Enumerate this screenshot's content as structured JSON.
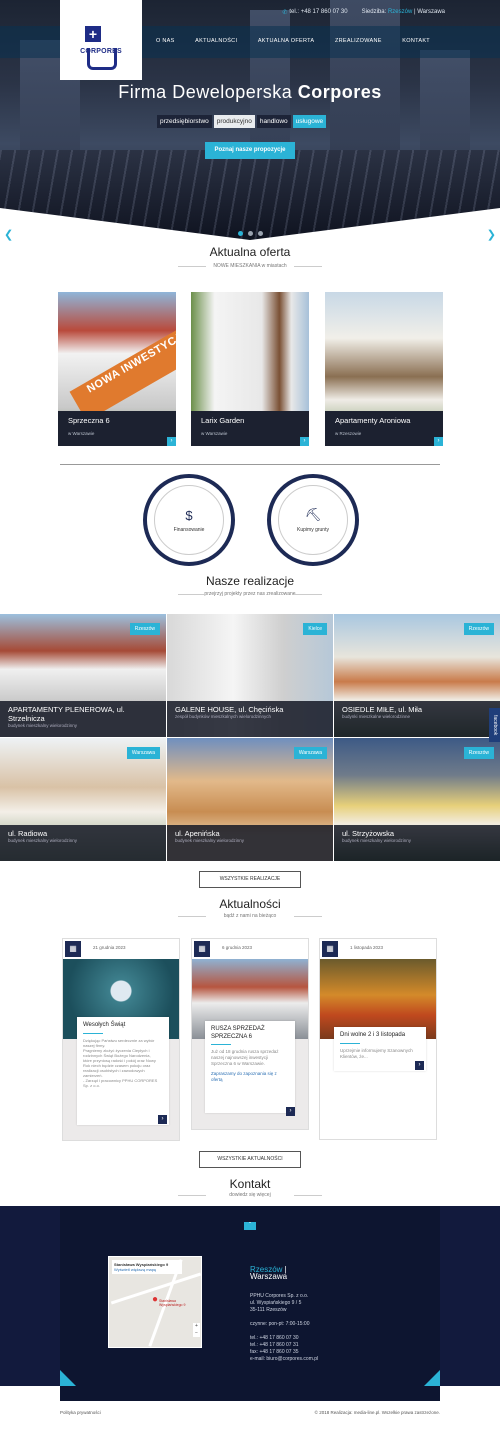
{
  "topbar": {
    "phone": "tel.: +48 17 860 07 30",
    "seat_label": "Siedziba:",
    "seat_active": "Rzeszów",
    "seat_other": "Warszawa"
  },
  "logo": {
    "text": "CORPORES"
  },
  "nav": [
    "O NAS",
    "AKTUALNOŚCI",
    "AKTUALNA OFERTA",
    "ZREALIZOWANE",
    "KONTAKT"
  ],
  "hero": {
    "title_light": "Firma Deweloperska ",
    "title_bold": "Corpores",
    "tags": [
      "przedsiębiorstwo",
      "produkcyjno",
      "handlowo",
      "usługowe"
    ],
    "button": "Poznaj nasze propozycje"
  },
  "offer": {
    "title": "Aktualna oferta",
    "subtitle": "NOWE MIESZKANIA w miastach",
    "cards": [
      {
        "name": "Sprzeczna 6",
        "city": "w Warszawie",
        "ribbon": "NOWA INWESTYCJA"
      },
      {
        "name": "Larix Garden",
        "city": "w Warszawie"
      },
      {
        "name": "Apartamenty Aroniowa",
        "city": "w Rzeszowie"
      }
    ]
  },
  "services": [
    "Finansowanie",
    "Kupimy grunty"
  ],
  "realizations": {
    "title": "Nasze realizacje",
    "subtitle": "przejrzyj projekty przez nas zrealizowane",
    "tiles": [
      {
        "name": "APARTAMENTY PLENEROWA, ul. Strzelnicza",
        "desc": "budynek mieszkalny wielorodzinny",
        "city": "Rzeszów"
      },
      {
        "name": "GALENE HOUSE, ul. Chęcińska",
        "desc": "zespół budynków mieszkalnych wielorodzinnych",
        "city": "Kielce"
      },
      {
        "name": "OSIEDLE MIŁE, ul. Miła",
        "desc": "budynki mieszkalne wielorodzinne",
        "city": "Rzeszów"
      },
      {
        "name": "ul. Radiowa",
        "desc": "budynek mieszkalny wielorodzinny",
        "city": "Warszawa"
      },
      {
        "name": "ul. Apenińska",
        "desc": "budynek mieszkalny wielorodzinny",
        "city": "Warszawa"
      },
      {
        "name": "ul. Strzyżowska",
        "desc": "budynek mieszkalny wielorodzinny",
        "city": "Rzeszów"
      }
    ],
    "all_button": "WSZYSTKIE REALIZACJE",
    "facebook": "facebook"
  },
  "news": {
    "title": "Aktualności",
    "subtitle": "bądź z nami na bieżąco",
    "items": [
      {
        "date": "21 grudnia 2023",
        "title": "Wesołych Świąt",
        "body": "Dziękując Państwu serdecznie za wybór naszej firmy.\nPragniemy złożyć życzenia Ciepłych i rodzinnych Świąt Bożego Narodzenia,\nktóre przyniosą radość i pokój oraz Nowy Rok niech będzie czasem pokoju oraz realizacji osobistych i zawodowych zamierzeń.\n- Zarząd i pracownicy PPHU CORPORES Sp. z o.o.",
        "link": ""
      },
      {
        "date": "6 grudnia 2023",
        "title": "RUSZA SPRZEDAŻ SPRZECZNA 6",
        "body": "Już od 18 grudnia rusza sprzedaż naszej najnowszej inwestycji Sprzeczna 6 w Warszawie.",
        "link": "Zapraszamy do zapoznania się z ofertą"
      },
      {
        "date": "1 listopada 2023",
        "title": "Dni wolne 2 i 3 listopada",
        "body": "Uprzejmie informujemy Szanownych Klientów, że...",
        "link": ""
      }
    ],
    "all_button": "WSZYSTKIE AKTUALNOŚCI"
  },
  "contact": {
    "title": "Kontakt",
    "subtitle": "dowiedz się więcej",
    "map_place": "Stanisława Wyspiańskiego 9",
    "map_link": "Wyświetl większą mapę",
    "map_pin": "Stanisława Wyspiańskiego 9",
    "city_active": "Rzeszów",
    "city_other": "Warszawa",
    "details": "PPHU Corpores Sp. z o.o.\nul. Wyspiańskiego 9 / 5\n35-111 Rzeszów\n\nczynne: pon-pt: 7:00-15:00\n\ntel.: +48 17 860 07 30\ntel.: +48 17 860 07 31\nfax: +48 17 860 07 35\ne-mail: biuro@corpores.com.pl"
  },
  "footer": {
    "privacy": "Polityka prywatności",
    "copyright": "© 2018 Realizacja: media-line.pl. Wszelkie prawa zastrzeżone."
  }
}
